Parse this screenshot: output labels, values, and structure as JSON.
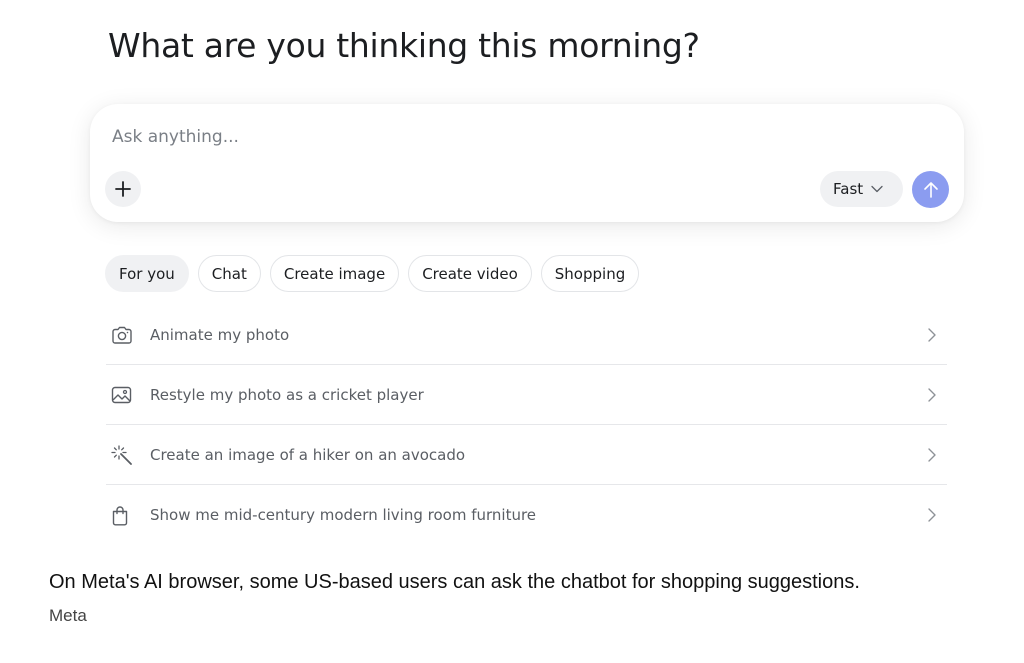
{
  "heading": "What are you thinking this morning?",
  "composer": {
    "placeholder": "Ask anything...",
    "mode_label": "Fast",
    "add_icon": "plus-icon",
    "send_icon": "arrow-up-icon",
    "send_color": "#8b9cf0"
  },
  "tabs": [
    {
      "label": "For you",
      "active": true
    },
    {
      "label": "Chat"
    },
    {
      "label": "Create image"
    },
    {
      "label": "Create video"
    },
    {
      "label": "Shopping"
    }
  ],
  "suggestions": [
    {
      "icon": "camera-icon",
      "text": "Animate my photo"
    },
    {
      "icon": "image-icon",
      "text": "Restyle my photo as a cricket player"
    },
    {
      "icon": "magic-wand-icon",
      "text": "Create an image of a hiker on an avocado"
    },
    {
      "icon": "shopping-bag-icon",
      "text": "Show me mid-century modern living room furniture"
    }
  ],
  "caption": "On Meta's AI browser, some US-based users can ask the chatbot for shopping suggestions.",
  "credit": "Meta"
}
